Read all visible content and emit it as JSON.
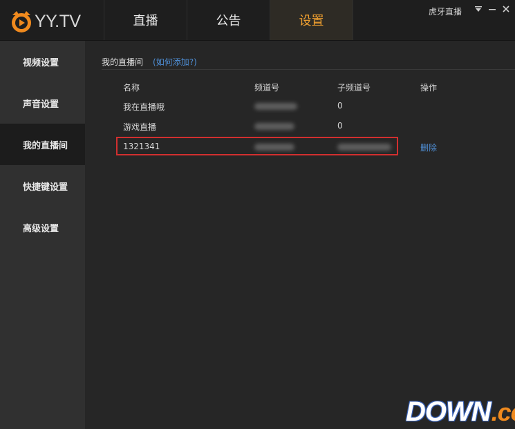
{
  "app": {
    "logo_text": "YY.TV",
    "room_name": "虎牙直播",
    "accent_color": "#f0a030",
    "link_color": "#4f8fd6",
    "highlight_color": "#d22f2f"
  },
  "nav": {
    "tabs": [
      {
        "label": "直播"
      },
      {
        "label": "公告"
      },
      {
        "label": "设置",
        "active": true
      }
    ]
  },
  "window_controls": {
    "menu_icon": "dropdown-menu-icon",
    "minimize_icon": "minimize-icon",
    "close_icon": "close-icon"
  },
  "sidebar": {
    "items": [
      {
        "label": "视频设置"
      },
      {
        "label": "声音设置"
      },
      {
        "label": "我的直播间",
        "active": true
      },
      {
        "label": "快捷键设置"
      },
      {
        "label": "高级设置"
      }
    ]
  },
  "content": {
    "title": "我的直播间",
    "help_link": "(如何添加?)",
    "columns": [
      "名称",
      "频道号",
      "子频道号",
      "操作"
    ],
    "rows": [
      {
        "name": "我在直播哦",
        "sub_channel": "0"
      },
      {
        "name": "游戏直播",
        "sub_channel": "0"
      },
      {
        "name": "1321341",
        "action": "删除"
      }
    ]
  },
  "watermark": {
    "main": "DOWN",
    "suffix": ".cc"
  }
}
